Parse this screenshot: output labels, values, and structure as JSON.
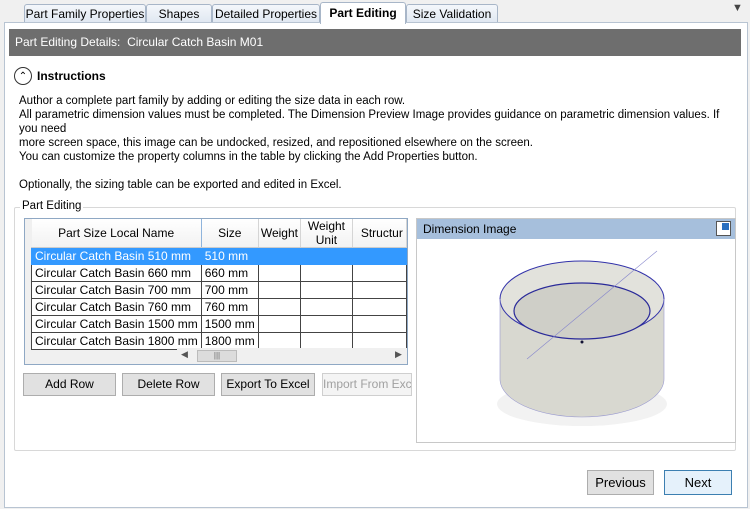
{
  "tabs": [
    "Part Family Properties",
    "Shapes",
    "Detailed Properties",
    "Part Editing",
    "Size Validation"
  ],
  "header": {
    "label": "Part Editing Details:",
    "name": "Circular Catch Basin M01"
  },
  "instructions": {
    "title": "Instructions",
    "lines": [
      "Author a complete part family by adding or editing the size data in each row.",
      "All parametric dimension values must be completed. The Dimension Preview Image provides guidance on parametric dimension values. If you need",
      "more screen space, this image can be undocked, resized, and repositioned elsewhere on the screen.",
      "You can customize the property columns in the table by clicking the Add Properties button.",
      "Optionally, the sizing table can be exported and edited in Excel."
    ]
  },
  "group_label": "Part Editing",
  "table": {
    "columns": [
      "Part Size Local Name",
      "Size",
      "Weight",
      "Weight Unit",
      "Structur"
    ],
    "rows": [
      [
        "Circular Catch Basin 510 mm",
        "510 mm"
      ],
      [
        "Circular Catch Basin 660 mm",
        "660 mm"
      ],
      [
        "Circular Catch Basin 700 mm",
        "700 mm"
      ],
      [
        "Circular Catch Basin 760 mm",
        "760 mm"
      ],
      [
        "Circular Catch Basin 1500 mm",
        "1500 mm"
      ],
      [
        "Circular Catch Basin 1800 mm",
        "1800 mm"
      ]
    ]
  },
  "buttons": {
    "add": "Add Row",
    "delete": "Delete Row",
    "export": "Export To Excel",
    "import": "Import From Excel",
    "previous": "Previous",
    "next": "Next"
  },
  "image_panel": {
    "title": "Dimension Image"
  }
}
